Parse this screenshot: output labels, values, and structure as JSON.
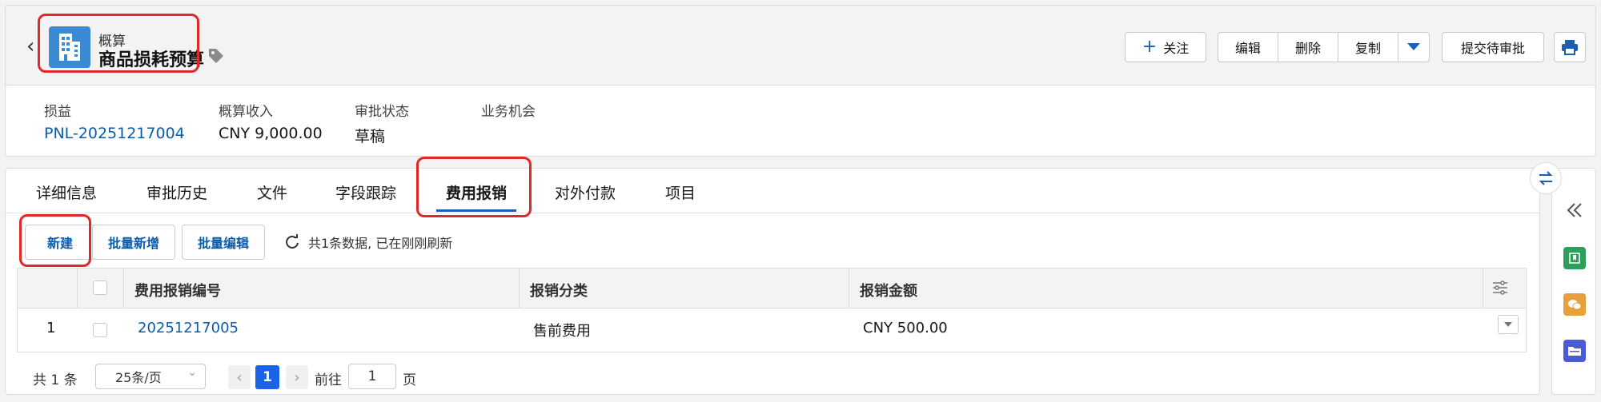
{
  "header": {
    "object_type": "概算",
    "record_name": "商品损耗预算",
    "buttons": {
      "follow": "关注",
      "edit": "编辑",
      "delete": "删除",
      "copy": "复制",
      "submit": "提交待审批"
    },
    "colors": {
      "object_icon": "#3b8bd4",
      "highlight_box": "#e02828"
    }
  },
  "highlights": [
    {
      "label": "损益",
      "value": "PNL-20251217004"
    },
    {
      "label": "概算收入",
      "value": "CNY 9,000.00"
    },
    {
      "label": "审批状态",
      "value": "草稿"
    },
    {
      "label": "业务机会",
      "value": ""
    }
  ],
  "tabs": [
    "详细信息",
    "审批历史",
    "文件",
    "字段跟踪",
    "费用报销",
    "对外付款",
    "项目"
  ],
  "active_tab": "费用报销",
  "related_list": {
    "buttons": {
      "new": "新建",
      "batch_add": "批量新增",
      "batch_edit": "批量编辑"
    },
    "status_text": "共1条数据, 已在刚刚刷新",
    "columns": [
      "费用报销编号",
      "报销分类",
      "报销金额"
    ],
    "rows": [
      {
        "index": "1",
        "number": "20251217005",
        "category": "售前费用",
        "amount": "CNY 500.00"
      }
    ]
  },
  "pagination": {
    "total_text": "共 1 条",
    "page_size": "25条/页",
    "current_page": "1",
    "goto_label": "前往",
    "goto_value": "1",
    "page_suffix": "页"
  }
}
